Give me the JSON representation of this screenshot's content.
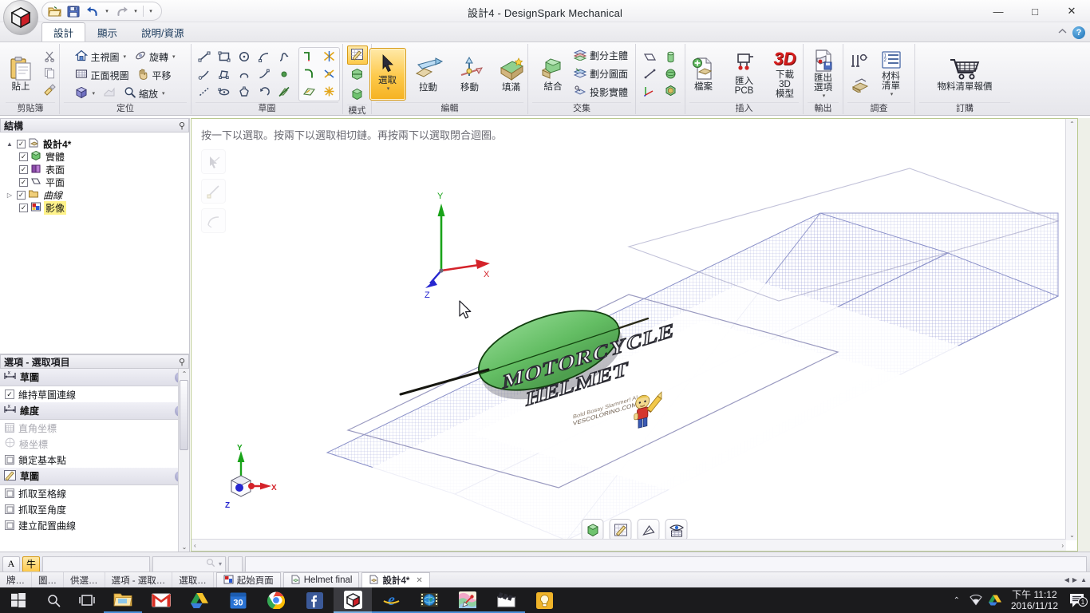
{
  "window": {
    "title": "設計4 - DesignSpark Mechanical",
    "minimize": "—",
    "maximize": "□",
    "close": "✕"
  },
  "quick_access": {
    "open_icon": "open-folder-icon",
    "save_icon": "save-disk-icon",
    "undo_icon": "undo-arrow-icon",
    "redo_icon": "redo-arrow-icon",
    "customize_icon": "customize-chevron-icon",
    "dropdown_caret": "▾"
  },
  "tabs": {
    "items": [
      {
        "label": "設計",
        "active": true
      },
      {
        "label": "顯示",
        "active": false
      },
      {
        "label": "說明/資源",
        "active": false
      }
    ],
    "help_icon": "help-circle-icon",
    "help_glyph": "?",
    "minimize_ribbon_icon": "minimize-ribbon-icon"
  },
  "ribbon": {
    "groups": [
      {
        "name": "clipboard",
        "label": "剪貼簿",
        "paste": {
          "label": "貼上",
          "icon": "paste-clipboard-icon"
        },
        "cut": {
          "icon": "scissors-icon"
        },
        "copy": {
          "icon": "copy-pages-icon"
        },
        "format_painter": {
          "icon": "format-painter-icon"
        }
      },
      {
        "name": "orient",
        "label": "定位",
        "items": [
          {
            "label": "主視圖",
            "icon": "home-view-icon",
            "dropdown": true
          },
          {
            "label": "旋轉",
            "icon": "rotate-icon",
            "dropdown": true
          },
          {
            "label": "正面視圖",
            "icon": "front-view-icon",
            "dropdown": false
          },
          {
            "label": "平移",
            "icon": "pan-hand-icon",
            "dropdown": false
          },
          {
            "label": "",
            "icon": "view-cube-icon",
            "dropdown": true
          },
          {
            "label": "",
            "icon": "previous-view-icon",
            "dropdown": false
          },
          {
            "label": "縮放",
            "icon": "zoom-magnifier-icon",
            "dropdown": true
          }
        ]
      },
      {
        "name": "sketch",
        "label": "草圖",
        "tools": [
          "line-icon",
          "rectangle-icon",
          "circle-icon",
          "tangent-arc-icon",
          "spline-icon",
          "line-arc-icon",
          "polygon-icon",
          "three-point-arc-icon",
          "curve-icon",
          "point-icon",
          "construction-line-icon",
          "ellipse-icon",
          "polygon-shape-icon",
          "sweep-arc-icon",
          "sketch-off-icon"
        ],
        "edit_tools": [
          "trim-corner-icon",
          "trim-away-icon",
          "fillet-icon",
          "split-icon",
          "project-icon",
          "explode-icon"
        ]
      },
      {
        "name": "mode",
        "label": "模式",
        "items": [
          {
            "icon": "sketch-mode-icon",
            "selected": true
          },
          {
            "icon": "section-mode-icon",
            "selected": false
          },
          {
            "icon": "solid-mode-icon",
            "selected": false
          }
        ]
      },
      {
        "name": "edit",
        "label": "編輯",
        "items": [
          {
            "label": "選取",
            "icon": "select-arrow-icon",
            "selected": true,
            "dropdown": true
          },
          {
            "label": "拉動",
            "icon": "pull-icon",
            "selected": false
          },
          {
            "label": "移動",
            "icon": "move-icon",
            "selected": false
          },
          {
            "label": "填滿",
            "icon": "fill-icon",
            "selected": false
          }
        ]
      },
      {
        "name": "intersect",
        "label": "交集",
        "combine": {
          "label": "結合",
          "icon": "combine-icon"
        },
        "items": [
          {
            "label": "劃分主體",
            "icon": "split-body-icon"
          },
          {
            "label": "劃分圖面",
            "icon": "split-face-icon"
          },
          {
            "label": "投影實體",
            "icon": "project-solid-icon"
          }
        ]
      },
      {
        "name": "create",
        "label": "",
        "tools": [
          "plane-icon",
          "cylinder-icon",
          "axis-line-icon",
          "sphere-icon",
          "origin-icon",
          "shape-icon"
        ]
      },
      {
        "name": "insert",
        "label": "插入",
        "items": [
          {
            "label": "檔案",
            "icon": "insert-file-icon"
          },
          {
            "label": "匯入\nPCB",
            "icon": "import-pcb-icon"
          },
          {
            "label": "下載 3D\n模型",
            "icon": "download-3d-icon",
            "glyph": "3D"
          }
        ]
      },
      {
        "name": "output",
        "label": "輸出",
        "items": [
          {
            "label": "匯出\n選項",
            "icon": "export-options-icon",
            "dropdown": true
          }
        ]
      },
      {
        "name": "survey",
        "label": "調查",
        "items": [
          {
            "icon": "measure-caliper-icon"
          },
          {
            "label": "材料\n清單",
            "icon": "bom-list-icon",
            "dropdown": true
          },
          {
            "icon": "mass-properties-icon"
          }
        ]
      },
      {
        "name": "order",
        "label": "訂購",
        "items": [
          {
            "label": "物料清單報價",
            "icon": "shopping-cart-icon"
          }
        ]
      }
    ]
  },
  "structure": {
    "title": "結構",
    "pin_icon": "pin-icon",
    "pin_glyph": "⚲",
    "root": {
      "label": "設計4*",
      "icon": "design-doc-icon",
      "checked": true,
      "expanded": true
    },
    "children": [
      {
        "label": "實體",
        "icon": "solid-green-icon",
        "checked": true
      },
      {
        "label": "表面",
        "icon": "surface-purple-icon",
        "checked": true
      },
      {
        "label": "平面",
        "icon": "plane-white-icon",
        "checked": true
      },
      {
        "label": "曲線",
        "icon": "curve-folder-icon",
        "checked": true,
        "italic": true,
        "expandable": true
      },
      {
        "label": "影像",
        "icon": "image-icon",
        "checked": true,
        "highlighted": true
      }
    ]
  },
  "options": {
    "title": "選項 - 選取項目",
    "pin_glyph": "⚲",
    "sections": [
      {
        "label": "草圖",
        "icon": "dimension-icon",
        "collapse_glyph": "⌃",
        "rows": [
          {
            "label": "維持草圖連線",
            "checked": true,
            "disabled": false,
            "icon": "checkbox-icon"
          }
        ]
      },
      {
        "label": "維度",
        "icon": "dimension-icon",
        "collapse_glyph": "⌃",
        "rows": [
          {
            "label": "直角坐標",
            "checked": false,
            "disabled": true,
            "icon": "grid-icon"
          },
          {
            "label": "極坐標",
            "checked": false,
            "disabled": true,
            "icon": "polar-icon"
          },
          {
            "label": "鎖定基本點",
            "checked": false,
            "disabled": false,
            "icon": "lock-point-icon"
          }
        ]
      },
      {
        "label": "草圖",
        "icon": "sketch-pencil-icon",
        "collapse_glyph": "⌃",
        "rows": [
          {
            "label": "抓取至格線",
            "checked": false,
            "disabled": false,
            "icon": "snap-grid-icon"
          },
          {
            "label": "抓取至角度",
            "checked": false,
            "disabled": false,
            "icon": "snap-angle-icon"
          },
          {
            "label": "建立配置曲線",
            "checked": false,
            "disabled": false,
            "icon": "layout-curve-icon"
          }
        ]
      }
    ]
  },
  "viewport": {
    "prompt": "按一下以選取。按兩下以選取相切鏈。再按兩下以選取閉合迴圈。",
    "ghost_buttons": [
      {
        "icon": "select-tool-ghost-icon"
      },
      {
        "icon": "line-tool-ghost-icon"
      },
      {
        "icon": "arc-tool-ghost-icon"
      }
    ],
    "bottom_buttons": [
      {
        "icon": "solid-mode-icon"
      },
      {
        "icon": "sketch-mode-icon"
      },
      {
        "icon": "section-mode-icon"
      },
      {
        "icon": "display-grid-icon"
      }
    ],
    "axis_triad": {
      "x": "X",
      "y": "Y",
      "z": "Z"
    },
    "view_cube": {
      "x": "X",
      "y": "Y",
      "z": "Z"
    },
    "image_text": {
      "line1": "MOTORCYCLE",
      "line2": "HELMET",
      "credit1": "Bold Bossy Slammer! A!",
      "credit2": "VESCOLORING.COM"
    },
    "scroll_up_glyph": "⌃",
    "scroll_down_glyph": "⌄",
    "scroll_left_glyph": "‹",
    "scroll_right_glyph": "›"
  },
  "bottom_toolbar": {
    "buttons": [
      {
        "icon": "text-tool-icon",
        "glyph": "A",
        "selected": false
      },
      {
        "icon": "units-tool-icon",
        "glyph": "牛",
        "selected": true
      }
    ],
    "field_placeholder": "",
    "dropdown_glyph": "▾",
    "magnifier_icon": "magnifier-icon"
  },
  "statusbar": {
    "items": [
      "牌…",
      "圖…",
      "供選…",
      "選項 - 選取…",
      "選取…"
    ],
    "tabs": [
      {
        "label": "起始頁面",
        "icon": "start-page-icon",
        "active": false
      },
      {
        "label": "Helmet final",
        "icon": "doc-icon",
        "active": false
      },
      {
        "label": "設計4*",
        "icon": "design-doc-icon",
        "active": true,
        "close_glyph": "✕"
      }
    ],
    "nav_left": "◀",
    "nav_right": "▶",
    "nav_up": "▲"
  },
  "taskbar": {
    "start_icon": "windows-start-icon",
    "search_icon": "search-icon",
    "taskview_icon": "task-view-icon",
    "apps": [
      {
        "icon": "file-explorer-icon",
        "name": "file-explorer"
      },
      {
        "icon": "gmail-icon",
        "name": "gmail"
      },
      {
        "icon": "google-drive-icon",
        "name": "google-drive"
      },
      {
        "icon": "calendar-icon",
        "name": "calendar",
        "glyph": "30"
      },
      {
        "icon": "chrome-icon",
        "name": "chrome"
      },
      {
        "icon": "facebook-icon",
        "name": "facebook",
        "glyph": "f"
      },
      {
        "icon": "designspark-icon",
        "name": "designspark",
        "active": true
      },
      {
        "icon": "internet-explorer-icon",
        "name": "internet-explorer",
        "glyph": "e"
      },
      {
        "icon": "media-globe-icon",
        "name": "media-player"
      },
      {
        "icon": "paint-icon",
        "name": "paint"
      },
      {
        "icon": "movie-maker-icon",
        "name": "movie-maker"
      },
      {
        "icon": "idea-bulb-icon",
        "name": "idea-app"
      }
    ],
    "tray": {
      "show_hidden_glyph": "⌃",
      "network_icon": "wifi-icon",
      "drive_icon": "google-drive-tray-icon",
      "time": "下午 11:12",
      "date": "2016/11/12",
      "notification_icon": "notification-icon",
      "notification_count": "1"
    }
  },
  "colors": {
    "accent_orange": "#fdc94a",
    "highlight_yellow": "#fff38a",
    "axis_x": "#d4232a",
    "axis_y": "#19a319",
    "axis_z": "#2626cf",
    "body_green": "#6ec36e",
    "grid_blue": "#9aa0d8",
    "taskbar": "#1b1b1d"
  }
}
